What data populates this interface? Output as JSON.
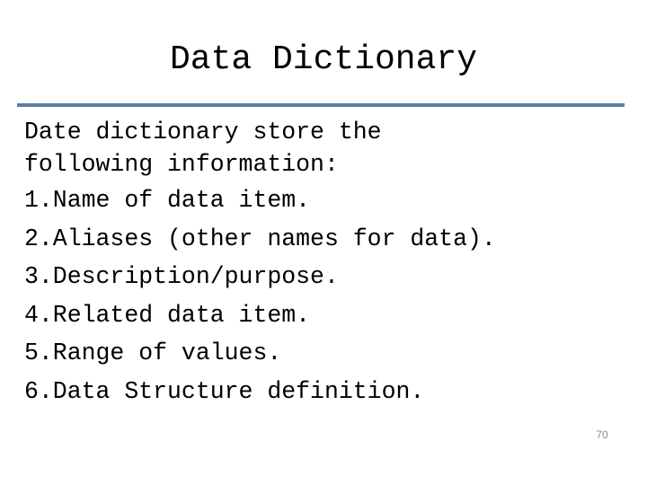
{
  "slide": {
    "title": "Data Dictionary",
    "intro_lines": [
      "Date dictionary store the",
      "following information:"
    ],
    "items": [
      "1.Name of data item.",
      "2.Aliases (other names for data).",
      "3.Description/purpose.",
      "4.Related data item.",
      "5.Range of values.",
      "6.Data Structure definition."
    ],
    "page_number": "70",
    "accent_color": "#5b7fa3"
  }
}
